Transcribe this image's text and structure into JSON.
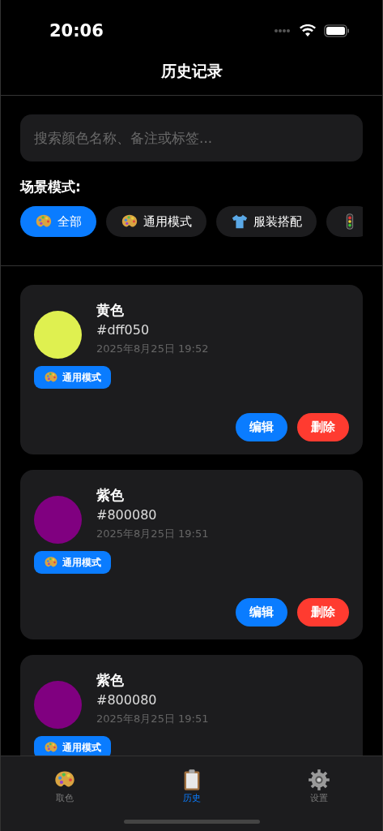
{
  "status_bar": {
    "time": "20:06"
  },
  "nav": {
    "title": "历史记录"
  },
  "search": {
    "placeholder": "搜索颜色名称、备注或标签..."
  },
  "scene_label": "场景模式:",
  "scenes": [
    {
      "kind": "palette",
      "label": "全部",
      "selected": true
    },
    {
      "kind": "palette",
      "label": "通用模式",
      "selected": false
    },
    {
      "kind": "shirt",
      "label": "服装搭配",
      "selected": false
    },
    {
      "kind": "light",
      "selected": false
    }
  ],
  "records": [
    {
      "name": "黄色",
      "hex": "#dff050",
      "color": "#dff050",
      "time": "2025年8月25日 19:52",
      "tag": "通用模式",
      "buttons": [
        {
          "kind": "edit",
          "label": "编辑"
        },
        {
          "kind": "delete",
          "label": "删除"
        }
      ]
    },
    {
      "name": "紫色",
      "hex": "#800080",
      "color": "#800080",
      "time": "2025年8月25日 19:51",
      "tag": "通用模式",
      "buttons": [
        {
          "kind": "edit",
          "label": "编辑"
        },
        {
          "kind": "delete",
          "label": "删除"
        }
      ]
    },
    {
      "name": "紫色",
      "hex": "#800080",
      "color": "#800080",
      "time": "2025年8月25日 19:51",
      "tag": "通用模式"
    }
  ],
  "tab_bar": [
    {
      "kind": "palette",
      "label": "取色",
      "selected": false
    },
    {
      "kind": "clipboard",
      "label": "历史",
      "selected": true
    },
    {
      "kind": "gear",
      "label": "设置",
      "selected": false
    }
  ]
}
